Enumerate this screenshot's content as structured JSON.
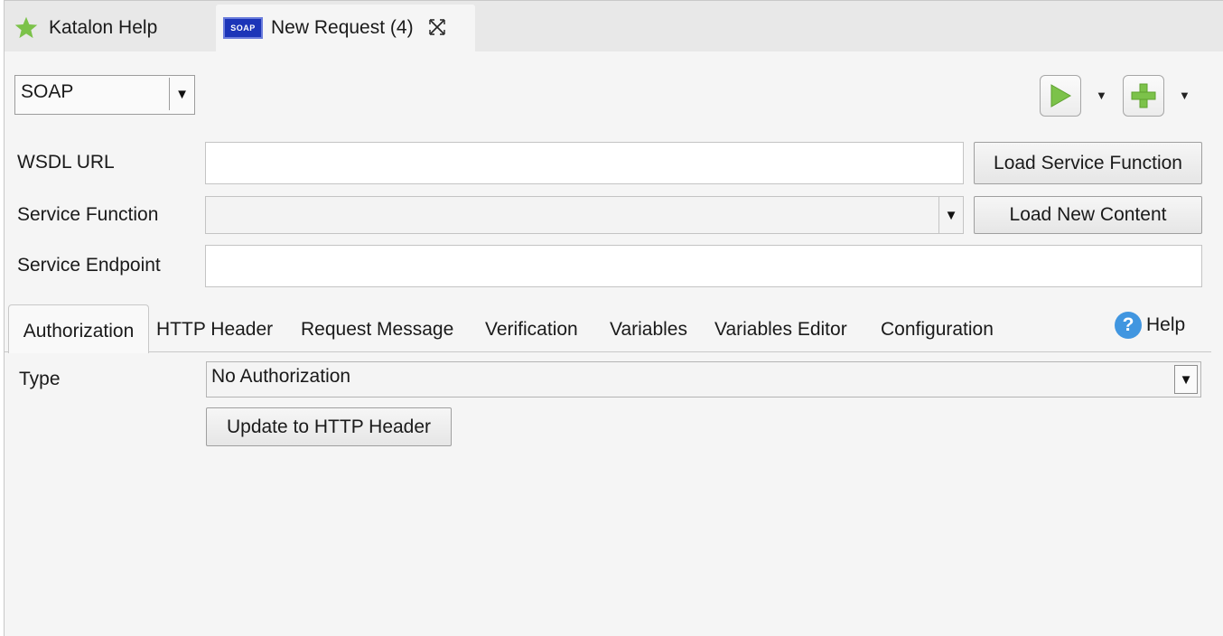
{
  "editor_tabs": [
    {
      "label": "Katalon Help",
      "icon": "star-icon"
    },
    {
      "label": "New Request (4)",
      "icon": "soap-icon",
      "icon_text": "SOAP"
    }
  ],
  "toolbar": {
    "method": "SOAP",
    "run_icon": "play-icon",
    "add_icon": "plus-icon",
    "accent_green": "#7cc24a"
  },
  "form": {
    "wsdl_label": "WSDL URL",
    "wsdl_value": "",
    "load_service_function_label": "Load Service Function",
    "service_function_label": "Service Function",
    "service_function_value": "",
    "load_new_content_label": "Load New Content",
    "service_endpoint_label": "Service Endpoint",
    "service_endpoint_value": ""
  },
  "section_tabs": [
    {
      "label": "Authorization",
      "active": true
    },
    {
      "label": "HTTP Header"
    },
    {
      "label": "Request Message"
    },
    {
      "label": "Verification"
    },
    {
      "label": "Variables"
    },
    {
      "label": "Variables Editor"
    },
    {
      "label": "Configuration"
    }
  ],
  "help": {
    "label": "Help",
    "icon": "question-icon"
  },
  "authorization": {
    "type_label": "Type",
    "type_value": "No Authorization",
    "update_button_label": "Update to HTTP Header"
  }
}
